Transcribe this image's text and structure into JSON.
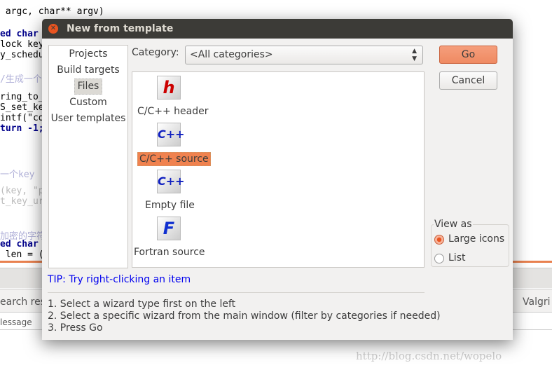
{
  "background": {
    "code_lines": [
      " argc, char** argv)",
      "ed char",
      "lock key",
      "y_schedu",
      "/生成一个",
      "ring_to_",
      "S_set_ke",
      "intf(\"co",
      "turn -1;",
      "一个key",
      "(key, \"p",
      "t_key_ur",
      "加密的字符",
      "ed char",
      " len = ("
    ],
    "search_tab": "earch resu",
    "message_col": "lessage",
    "valgrind_tab": "Valgri",
    "watermark": "http://blog.csdn.net/wopelo"
  },
  "dialog": {
    "title": "New from template",
    "categories_list": [
      "Projects",
      "Build targets",
      "Files",
      "Custom",
      "User templates"
    ],
    "selected_category": "Files",
    "category_label": "Category:",
    "category_value": "<All categories>",
    "items": [
      {
        "label": "C/C++ header",
        "icon": "h-header-icon",
        "glyph": "h"
      },
      {
        "label": "C/C++ source",
        "icon": "cpp-source-icon",
        "glyph": "C++"
      },
      {
        "label": "Empty file",
        "icon": "empty-file-icon",
        "glyph": "C++"
      },
      {
        "label": "Fortran source",
        "icon": "fortran-icon",
        "glyph": "F"
      }
    ],
    "selected_item": "C/C++ source",
    "go": "Go",
    "cancel": "Cancel",
    "view_as": {
      "title": "View as",
      "options": [
        "Large icons",
        "List"
      ],
      "selected": "Large icons"
    },
    "tip": "TIP: Try right-clicking an item",
    "instructions": [
      "1. Select a wizard type first on the left",
      "2. Select a specific wizard from the main window (filter by categories if needed)",
      "3. Press Go"
    ],
    "accent": "#e95420"
  }
}
